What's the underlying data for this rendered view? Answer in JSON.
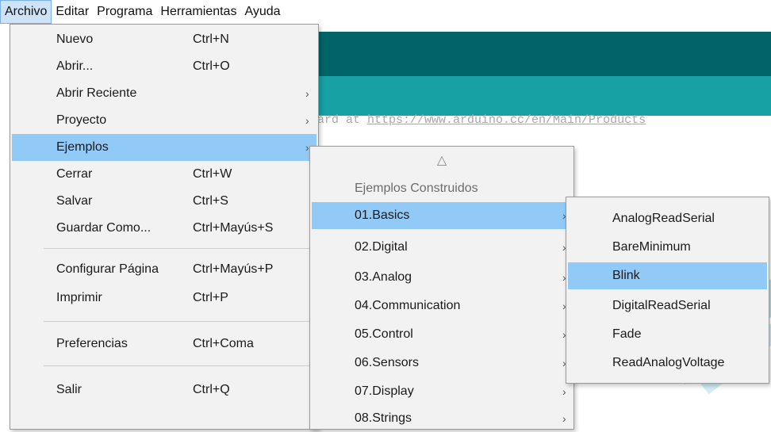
{
  "menubar": {
    "items": [
      "Archivo",
      "Editar",
      "Programa",
      "Herramientas",
      "Ayuda"
    ]
  },
  "editor": {
    "code_prefix": "ard  at ",
    "code_url": "https://www.arduino.cc/en/Main/Products"
  },
  "archivo_menu": {
    "items": [
      {
        "label": "Nuevo",
        "shortcut": "Ctrl+N"
      },
      {
        "label": "Abrir...",
        "shortcut": "Ctrl+O"
      },
      {
        "label": "Abrir Reciente",
        "shortcut": ""
      },
      {
        "label": "Proyecto",
        "shortcut": ""
      },
      {
        "label": "Ejemplos",
        "shortcut": ""
      },
      {
        "label": "Cerrar",
        "shortcut": "Ctrl+W"
      },
      {
        "label": "Salvar",
        "shortcut": "Ctrl+S"
      },
      {
        "label": "Guardar Como...",
        "shortcut": "Ctrl+Mayús+S"
      },
      {
        "label": "Configurar Página",
        "shortcut": "Ctrl+Mayús+P"
      },
      {
        "label": "Imprimir",
        "shortcut": "Ctrl+P"
      },
      {
        "label": "Preferencias",
        "shortcut": "Ctrl+Coma"
      },
      {
        "label": "Salir",
        "shortcut": "Ctrl+Q"
      }
    ],
    "submenu_arrow": "›"
  },
  "ejemplos_menu": {
    "scroll_up": "△",
    "header": "Ejemplos Construidos",
    "items": [
      "01.Basics",
      "02.Digital",
      "03.Analog",
      "04.Communication",
      "05.Control",
      "06.Sensors",
      "07.Display",
      "08.Strings"
    ]
  },
  "basics_menu": {
    "items": [
      "AnalogReadSerial",
      "BareMinimum",
      "Blink",
      "DigitalReadSerial",
      "Fade",
      "ReadAnalogVoltage"
    ]
  },
  "colors": {
    "toolbar_dark": "#006468",
    "toolbar_teal": "#17a1a5",
    "highlight": "#91c9f7",
    "menu_bg": "#f2f2f2"
  }
}
